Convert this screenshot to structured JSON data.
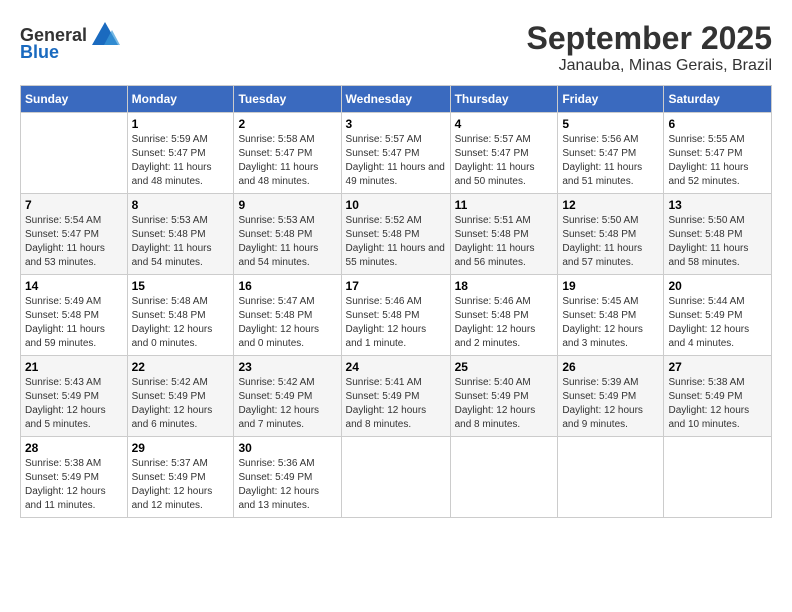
{
  "logo": {
    "text_general": "General",
    "text_blue": "Blue"
  },
  "title": "September 2025",
  "subtitle": "Janauba, Minas Gerais, Brazil",
  "days_of_week": [
    "Sunday",
    "Monday",
    "Tuesday",
    "Wednesday",
    "Thursday",
    "Friday",
    "Saturday"
  ],
  "weeks": [
    [
      {
        "day": "",
        "sunrise": "",
        "sunset": "",
        "daylight": ""
      },
      {
        "day": "1",
        "sunrise": "Sunrise: 5:59 AM",
        "sunset": "Sunset: 5:47 PM",
        "daylight": "Daylight: 11 hours and 48 minutes."
      },
      {
        "day": "2",
        "sunrise": "Sunrise: 5:58 AM",
        "sunset": "Sunset: 5:47 PM",
        "daylight": "Daylight: 11 hours and 48 minutes."
      },
      {
        "day": "3",
        "sunrise": "Sunrise: 5:57 AM",
        "sunset": "Sunset: 5:47 PM",
        "daylight": "Daylight: 11 hours and 49 minutes."
      },
      {
        "day": "4",
        "sunrise": "Sunrise: 5:57 AM",
        "sunset": "Sunset: 5:47 PM",
        "daylight": "Daylight: 11 hours and 50 minutes."
      },
      {
        "day": "5",
        "sunrise": "Sunrise: 5:56 AM",
        "sunset": "Sunset: 5:47 PM",
        "daylight": "Daylight: 11 hours and 51 minutes."
      },
      {
        "day": "6",
        "sunrise": "Sunrise: 5:55 AM",
        "sunset": "Sunset: 5:47 PM",
        "daylight": "Daylight: 11 hours and 52 minutes."
      }
    ],
    [
      {
        "day": "7",
        "sunrise": "Sunrise: 5:54 AM",
        "sunset": "Sunset: 5:47 PM",
        "daylight": "Daylight: 11 hours and 53 minutes."
      },
      {
        "day": "8",
        "sunrise": "Sunrise: 5:53 AM",
        "sunset": "Sunset: 5:48 PM",
        "daylight": "Daylight: 11 hours and 54 minutes."
      },
      {
        "day": "9",
        "sunrise": "Sunrise: 5:53 AM",
        "sunset": "Sunset: 5:48 PM",
        "daylight": "Daylight: 11 hours and 54 minutes."
      },
      {
        "day": "10",
        "sunrise": "Sunrise: 5:52 AM",
        "sunset": "Sunset: 5:48 PM",
        "daylight": "Daylight: 11 hours and 55 minutes."
      },
      {
        "day": "11",
        "sunrise": "Sunrise: 5:51 AM",
        "sunset": "Sunset: 5:48 PM",
        "daylight": "Daylight: 11 hours and 56 minutes."
      },
      {
        "day": "12",
        "sunrise": "Sunrise: 5:50 AM",
        "sunset": "Sunset: 5:48 PM",
        "daylight": "Daylight: 11 hours and 57 minutes."
      },
      {
        "day": "13",
        "sunrise": "Sunrise: 5:50 AM",
        "sunset": "Sunset: 5:48 PM",
        "daylight": "Daylight: 11 hours and 58 minutes."
      }
    ],
    [
      {
        "day": "14",
        "sunrise": "Sunrise: 5:49 AM",
        "sunset": "Sunset: 5:48 PM",
        "daylight": "Daylight: 11 hours and 59 minutes."
      },
      {
        "day": "15",
        "sunrise": "Sunrise: 5:48 AM",
        "sunset": "Sunset: 5:48 PM",
        "daylight": "Daylight: 12 hours and 0 minutes."
      },
      {
        "day": "16",
        "sunrise": "Sunrise: 5:47 AM",
        "sunset": "Sunset: 5:48 PM",
        "daylight": "Daylight: 12 hours and 0 minutes."
      },
      {
        "day": "17",
        "sunrise": "Sunrise: 5:46 AM",
        "sunset": "Sunset: 5:48 PM",
        "daylight": "Daylight: 12 hours and 1 minute."
      },
      {
        "day": "18",
        "sunrise": "Sunrise: 5:46 AM",
        "sunset": "Sunset: 5:48 PM",
        "daylight": "Daylight: 12 hours and 2 minutes."
      },
      {
        "day": "19",
        "sunrise": "Sunrise: 5:45 AM",
        "sunset": "Sunset: 5:48 PM",
        "daylight": "Daylight: 12 hours and 3 minutes."
      },
      {
        "day": "20",
        "sunrise": "Sunrise: 5:44 AM",
        "sunset": "Sunset: 5:49 PM",
        "daylight": "Daylight: 12 hours and 4 minutes."
      }
    ],
    [
      {
        "day": "21",
        "sunrise": "Sunrise: 5:43 AM",
        "sunset": "Sunset: 5:49 PM",
        "daylight": "Daylight: 12 hours and 5 minutes."
      },
      {
        "day": "22",
        "sunrise": "Sunrise: 5:42 AM",
        "sunset": "Sunset: 5:49 PM",
        "daylight": "Daylight: 12 hours and 6 minutes."
      },
      {
        "day": "23",
        "sunrise": "Sunrise: 5:42 AM",
        "sunset": "Sunset: 5:49 PM",
        "daylight": "Daylight: 12 hours and 7 minutes."
      },
      {
        "day": "24",
        "sunrise": "Sunrise: 5:41 AM",
        "sunset": "Sunset: 5:49 PM",
        "daylight": "Daylight: 12 hours and 8 minutes."
      },
      {
        "day": "25",
        "sunrise": "Sunrise: 5:40 AM",
        "sunset": "Sunset: 5:49 PM",
        "daylight": "Daylight: 12 hours and 8 minutes."
      },
      {
        "day": "26",
        "sunrise": "Sunrise: 5:39 AM",
        "sunset": "Sunset: 5:49 PM",
        "daylight": "Daylight: 12 hours and 9 minutes."
      },
      {
        "day": "27",
        "sunrise": "Sunrise: 5:38 AM",
        "sunset": "Sunset: 5:49 PM",
        "daylight": "Daylight: 12 hours and 10 minutes."
      }
    ],
    [
      {
        "day": "28",
        "sunrise": "Sunrise: 5:38 AM",
        "sunset": "Sunset: 5:49 PM",
        "daylight": "Daylight: 12 hours and 11 minutes."
      },
      {
        "day": "29",
        "sunrise": "Sunrise: 5:37 AM",
        "sunset": "Sunset: 5:49 PM",
        "daylight": "Daylight: 12 hours and 12 minutes."
      },
      {
        "day": "30",
        "sunrise": "Sunrise: 5:36 AM",
        "sunset": "Sunset: 5:49 PM",
        "daylight": "Daylight: 12 hours and 13 minutes."
      },
      {
        "day": "",
        "sunrise": "",
        "sunset": "",
        "daylight": ""
      },
      {
        "day": "",
        "sunrise": "",
        "sunset": "",
        "daylight": ""
      },
      {
        "day": "",
        "sunrise": "",
        "sunset": "",
        "daylight": ""
      },
      {
        "day": "",
        "sunrise": "",
        "sunset": "",
        "daylight": ""
      }
    ]
  ]
}
